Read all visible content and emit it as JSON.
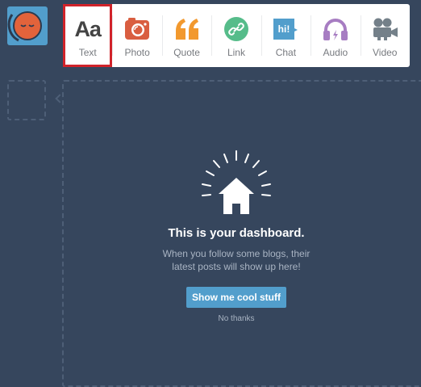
{
  "post_types": [
    {
      "key": "text",
      "label": "Text",
      "icon": "text-icon",
      "color": "#444444",
      "glyph": "Aa",
      "selected": true
    },
    {
      "key": "photo",
      "label": "Photo",
      "icon": "camera-icon",
      "color": "#d95e40"
    },
    {
      "key": "quote",
      "label": "Quote",
      "icon": "quote-icon",
      "color": "#f2992e"
    },
    {
      "key": "link",
      "label": "Link",
      "icon": "link-icon",
      "color": "#56bc8a"
    },
    {
      "key": "chat",
      "label": "Chat",
      "icon": "chat-icon",
      "color": "#529ecc",
      "glyph": "hi!"
    },
    {
      "key": "audio",
      "label": "Audio",
      "icon": "headphones-icon",
      "color": "#a77dc2"
    },
    {
      "key": "video",
      "label": "Video",
      "icon": "video-camera-icon",
      "color": "#748089"
    }
  ],
  "dashboard": {
    "title": "This is your dashboard.",
    "subtitle": "When you follow some blogs, their latest posts will show up here!",
    "cta_label": "Show me cool stuff",
    "dismiss_label": "No thanks"
  },
  "colors": {
    "background": "#36465d",
    "accent": "#529ecc",
    "avatar_face": "#e2633b",
    "selection_outline": "#d1232a"
  }
}
